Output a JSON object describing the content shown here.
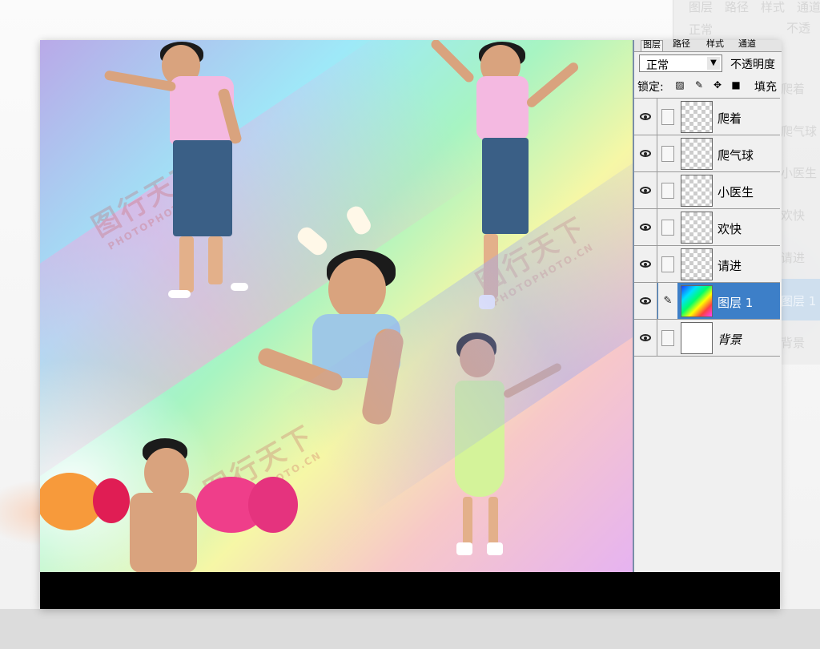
{
  "panel": {
    "tabs": [
      "图层",
      "路径",
      "样式",
      "通道"
    ],
    "blend_mode": "正常",
    "opacity_label": "不透明度",
    "lock_label": "锁定:",
    "fill_label": "填充"
  },
  "layers": [
    {
      "name": "爬着",
      "visible": true,
      "selected": false,
      "thumb": "transparent"
    },
    {
      "name": "爬气球",
      "visible": true,
      "selected": false,
      "thumb": "transparent"
    },
    {
      "name": "小医生",
      "visible": true,
      "selected": false,
      "thumb": "transparent"
    },
    {
      "name": "欢快",
      "visible": true,
      "selected": false,
      "thumb": "transparent"
    },
    {
      "name": "请进",
      "visible": true,
      "selected": false,
      "thumb": "transparent"
    },
    {
      "name": "图层 1",
      "visible": true,
      "selected": true,
      "thumb": "rainbow-gradient"
    },
    {
      "name": "背景",
      "visible": true,
      "selected": false,
      "thumb": "white"
    }
  ],
  "background_ghost": {
    "labels": [
      "图层",
      "路径",
      "样式",
      "通道",
      "正常",
      "不透",
      "爬着",
      "爬气球",
      "小医生",
      "欢快",
      "请进",
      "图层 1",
      "背景"
    ]
  },
  "watermark": {
    "text": "图行天下",
    "subtext": "PHOTOPHOTO.CN"
  },
  "colors": {
    "selection": "#3d7fc8",
    "panel_bg": "#f0f0f0"
  }
}
